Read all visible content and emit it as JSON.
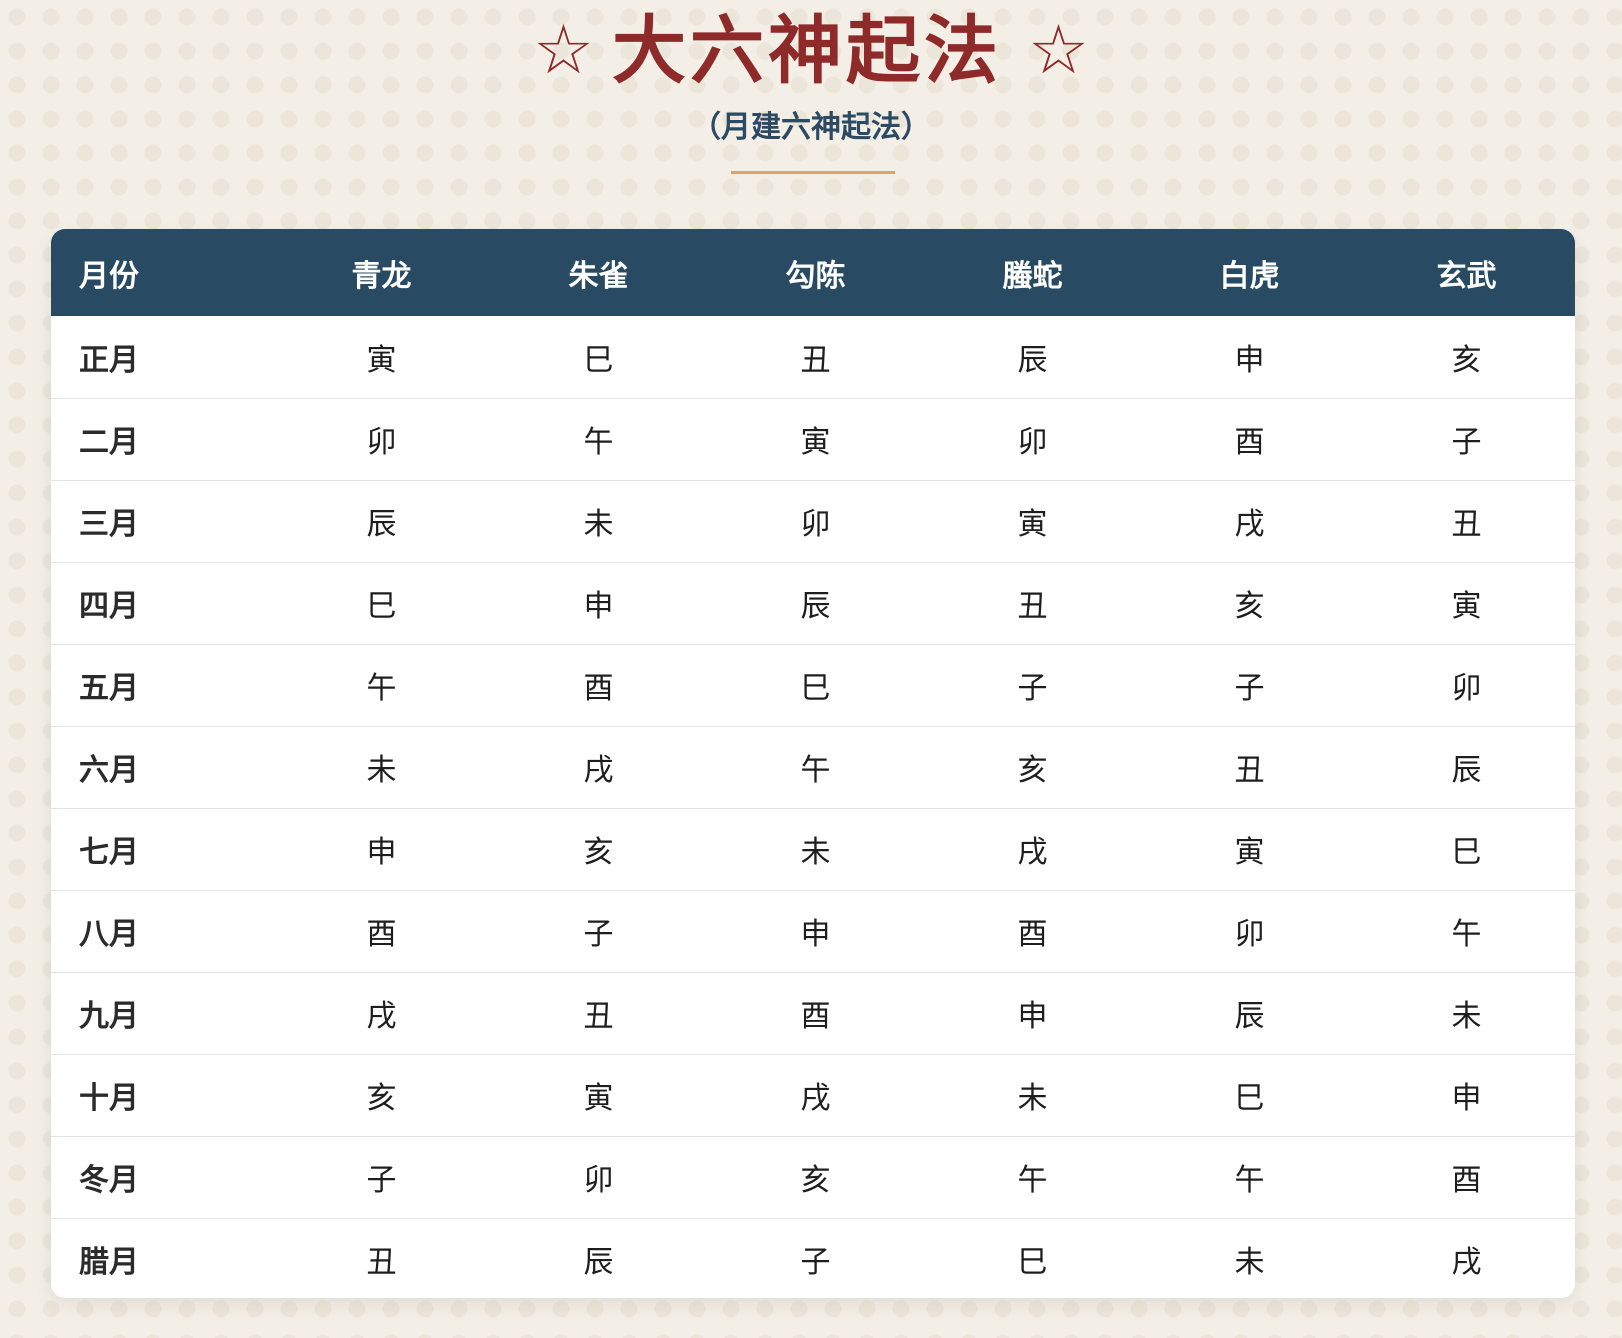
{
  "header": {
    "star_left": "☆",
    "title": "大六神起法",
    "star_right": "☆",
    "subtitle": "（月建六神起法）"
  },
  "table": {
    "columns": [
      "月份",
      "青龙",
      "朱雀",
      "勾陈",
      "螣蛇",
      "白虎",
      "玄武"
    ],
    "rows": [
      [
        "正月",
        "寅",
        "巳",
        "丑",
        "辰",
        "申",
        "亥"
      ],
      [
        "二月",
        "卯",
        "午",
        "寅",
        "卯",
        "酉",
        "子"
      ],
      [
        "三月",
        "辰",
        "未",
        "卯",
        "寅",
        "戌",
        "丑"
      ],
      [
        "四月",
        "巳",
        "申",
        "辰",
        "丑",
        "亥",
        "寅"
      ],
      [
        "五月",
        "午",
        "酉",
        "巳",
        "子",
        "子",
        "卯"
      ],
      [
        "六月",
        "未",
        "戌",
        "午",
        "亥",
        "丑",
        "辰"
      ],
      [
        "七月",
        "申",
        "亥",
        "未",
        "戌",
        "寅",
        "巳"
      ],
      [
        "八月",
        "酉",
        "子",
        "申",
        "酉",
        "卯",
        "午"
      ],
      [
        "九月",
        "戌",
        "丑",
        "酉",
        "申",
        "辰",
        "未"
      ],
      [
        "十月",
        "亥",
        "寅",
        "戌",
        "未",
        "巳",
        "申"
      ],
      [
        "冬月",
        "子",
        "卯",
        "亥",
        "午",
        "午",
        "酉"
      ],
      [
        "腊月",
        "丑",
        "辰",
        "子",
        "巳",
        "未",
        "戌"
      ]
    ]
  },
  "colors": {
    "title": "#8e2a2a",
    "subtitle": "#2c4a63",
    "header_bg": "#284a62",
    "divider": "#d8a56a",
    "page_bg": "#f4efe6"
  }
}
